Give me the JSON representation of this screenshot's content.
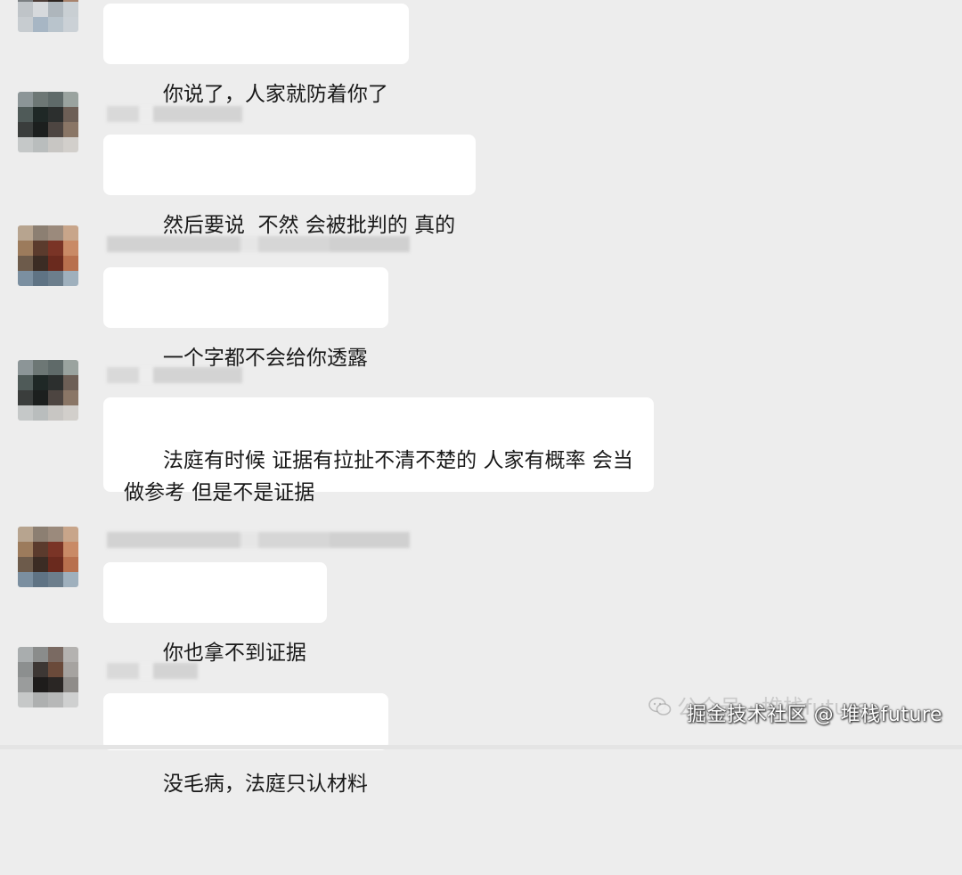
{
  "messages": [
    {
      "text": "你说了，人家就防着你了"
    },
    {
      "text": "然后要说  不然 会被批判的 真的"
    },
    {
      "text": "一个字都不会给你透露"
    },
    {
      "text": "法庭有时候 证据有拉扯不清不楚的 人家有概率 会当\n做参考 但是不是证据"
    },
    {
      "text": "你也拿不到证据"
    },
    {
      "text": "没毛病，法庭只认材料"
    }
  ],
  "watermark": {
    "faint": "公众号 · 堆栈future",
    "main": "掘金技术社区 @ 堆栈future"
  },
  "colors": {
    "background": "#ededed",
    "bubble": "#ffffff",
    "text": "#191919"
  }
}
